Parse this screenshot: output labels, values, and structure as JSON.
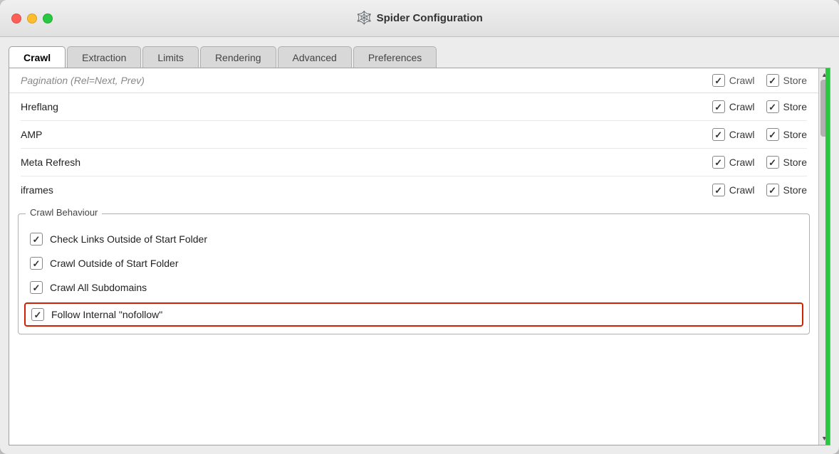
{
  "window": {
    "title": "Spider Configuration",
    "title_icon": "🕸️"
  },
  "traffic_lights": {
    "close_label": "close",
    "minimize_label": "minimize",
    "maximize_label": "maximize"
  },
  "tabs": [
    {
      "id": "crawl",
      "label": "Crawl",
      "active": true
    },
    {
      "id": "extraction",
      "label": "Extraction",
      "active": false
    },
    {
      "id": "limits",
      "label": "Limits",
      "active": false
    },
    {
      "id": "rendering",
      "label": "Rendering",
      "active": false
    },
    {
      "id": "advanced",
      "label": "Advanced",
      "active": false
    },
    {
      "id": "preferences",
      "label": "Preferences",
      "active": false
    }
  ],
  "header_row": {
    "crawl_label": "Crawl",
    "store_label": "Store"
  },
  "truncated_label": "Pagination (Rel=Next, Prev)",
  "link_rows": [
    {
      "id": "hreflang",
      "label": "Hreflang",
      "crawl_checked": true,
      "store_checked": true
    },
    {
      "id": "amp",
      "label": "AMP",
      "crawl_checked": true,
      "store_checked": true
    },
    {
      "id": "meta-refresh",
      "label": "Meta Refresh",
      "crawl_checked": true,
      "store_checked": true
    },
    {
      "id": "iframes",
      "label": "iframes",
      "crawl_checked": true,
      "store_checked": true
    }
  ],
  "crawl_behaviour": {
    "section_title": "Crawl Behaviour",
    "items": [
      {
        "id": "check-links-outside",
        "label": "Check Links Outside of Start Folder",
        "checked": true,
        "highlighted": false
      },
      {
        "id": "crawl-outside",
        "label": "Crawl Outside of Start Folder",
        "checked": true,
        "highlighted": false
      },
      {
        "id": "crawl-all-subdomains",
        "label": "Crawl All Subdomains",
        "checked": true,
        "highlighted": false
      },
      {
        "id": "follow-nofollow",
        "label": "Follow Internal \"nofollow\"",
        "checked": true,
        "highlighted": true
      }
    ]
  }
}
